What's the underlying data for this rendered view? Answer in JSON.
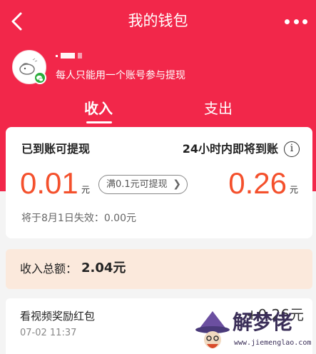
{
  "header": {
    "title": "我的钱包",
    "back_icon": "chevron-left-icon",
    "more_icon": "more-dots-icon"
  },
  "user": {
    "tip": "每人只能用一个账号参与提现",
    "avatar_icon": "avatar-icon",
    "badge_icon": "wechat-icon"
  },
  "tabs": [
    {
      "label": "收入",
      "active": true
    },
    {
      "label": "支出",
      "active": false
    }
  ],
  "balance": {
    "available_label": "已到账可提现",
    "available_amount": "0.01",
    "available_unit": "元",
    "withdraw_hint": "满0.1元可提现",
    "pending_label": "24小时内即将到账",
    "pending_amount": "0.26",
    "pending_unit": "元",
    "expire_text": "将于8月1日失效：0.00元",
    "info_icon": "info-icon"
  },
  "total": {
    "label": "收入总额：",
    "value": "2.04元"
  },
  "records": [
    {
      "title": "看视频奖励红包",
      "time": "07-02 11:37",
      "amount": "+0.26元"
    }
  ],
  "watermark": {
    "text": "解梦佬",
    "url": "www.jiemenglao.com"
  },
  "colors": {
    "brand": "#f2274a",
    "amount": "#f4502c",
    "total_bg": "#fbe9dc"
  }
}
